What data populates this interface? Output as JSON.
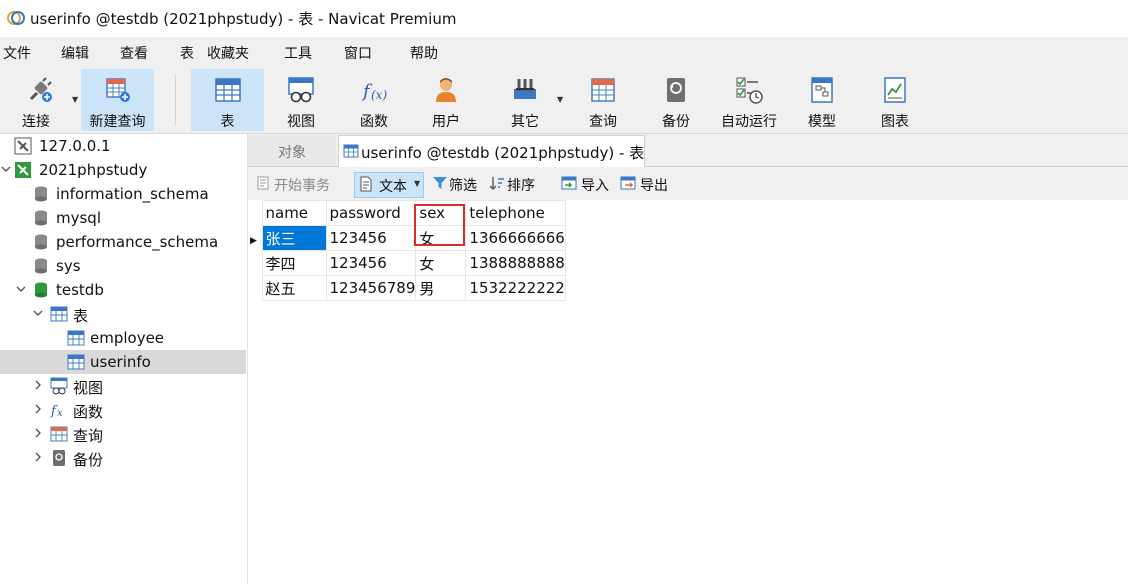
{
  "window": {
    "title": "userinfo @testdb (2021phpstudy) - 表 - Navicat Premium"
  },
  "menu": [
    "文件",
    "编辑",
    "查看",
    "表",
    "收藏夹",
    "工具",
    "窗口",
    "帮助"
  ],
  "toolbar": {
    "connect": "连接",
    "new_query": "新建查询",
    "table": "表",
    "view": "视图",
    "function": "函数",
    "user": "用户",
    "other": "其它",
    "query": "查询",
    "backup": "备份",
    "automation": "自动运行",
    "model": "模型",
    "chart": "图表"
  },
  "sidebar": {
    "items": [
      {
        "label": "127.0.0.1"
      },
      {
        "label": "2021phpstudy"
      },
      {
        "label": "information_schema"
      },
      {
        "label": "mysql"
      },
      {
        "label": "performance_schema"
      },
      {
        "label": "sys"
      },
      {
        "label": "testdb"
      },
      {
        "label": "表"
      },
      {
        "label": "employee"
      },
      {
        "label": "userinfo"
      },
      {
        "label": "视图"
      },
      {
        "label": "函数"
      },
      {
        "label": "查询"
      },
      {
        "label": "备份"
      }
    ]
  },
  "tabs": {
    "objects": "对象",
    "active": "userinfo @testdb (2021phpstudy) - 表"
  },
  "subtoolbar": {
    "begin_transaction": "开始事务",
    "text": "文本",
    "filter": "筛选",
    "sort": "排序",
    "import": "导入",
    "export": "导出"
  },
  "grid": {
    "columns": [
      "name",
      "password",
      "sex",
      "telephone"
    ],
    "rows": [
      [
        "张三",
        "123456",
        "女",
        "1366666666"
      ],
      [
        "李四",
        "123456",
        "女",
        "1388888888"
      ],
      [
        "赵五",
        "123456789",
        "男",
        "1532222222"
      ]
    ]
  },
  "colors": {
    "accent": "#0078d7",
    "highlight_box": "#d3302b",
    "active_tool": "#cce4f7"
  }
}
